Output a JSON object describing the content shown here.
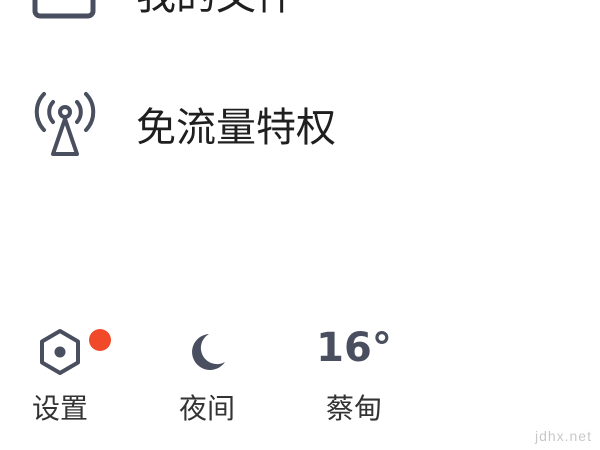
{
  "menu": {
    "items": [
      {
        "label": "我的文件",
        "icon": "folder-icon"
      },
      {
        "label": "免流量特权",
        "icon": "broadcast-signal-icon"
      }
    ]
  },
  "bottom_bar": {
    "settings": {
      "label": "设置",
      "icon": "settings-hexagon-icon",
      "badge_color": "#f04a2a"
    },
    "night": {
      "label": "夜间",
      "icon": "moon-icon"
    },
    "weather": {
      "label": "蔡甸",
      "temperature": "16°"
    }
  },
  "watermark": "jdhx.net",
  "colors": {
    "icon": "#4a4f5f",
    "text": "#1f1f1f",
    "badge": "#f04a2a"
  }
}
